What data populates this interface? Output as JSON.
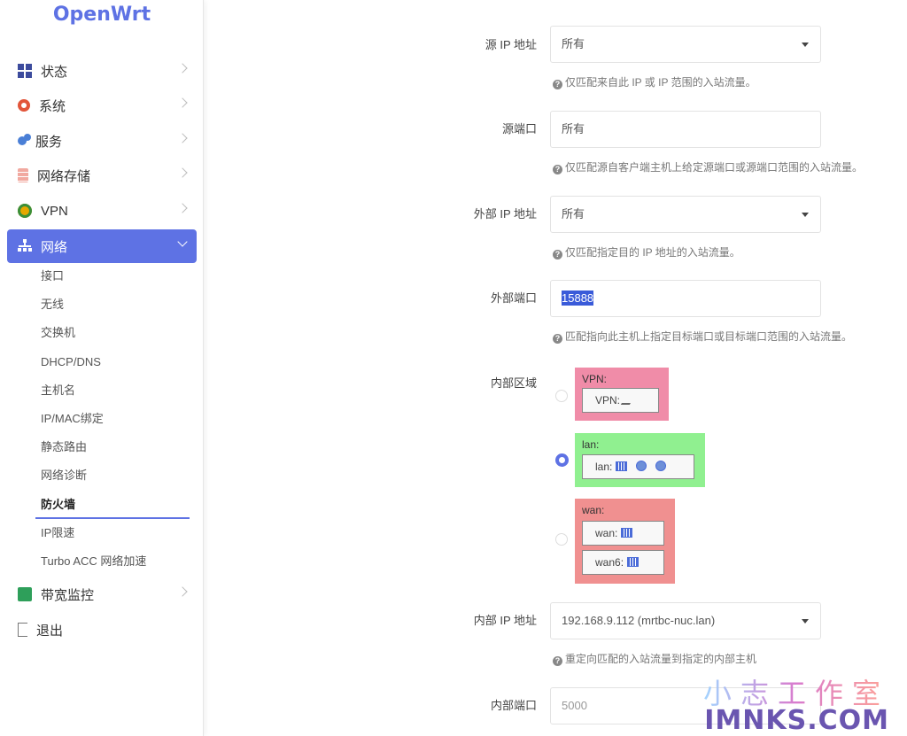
{
  "app": {
    "logo": "OpenWrt"
  },
  "sidebar": {
    "items": [
      {
        "label": "状态",
        "icon": "status-icon"
      },
      {
        "label": "系统",
        "icon": "gear-icon"
      },
      {
        "label": "服务",
        "icon": "services-icon"
      },
      {
        "label": "网络存储",
        "icon": "storage-icon"
      },
      {
        "label": "VPN",
        "icon": "vpn-icon"
      },
      {
        "label": "网络",
        "icon": "network-icon",
        "active": true
      },
      {
        "label": "带宽监控",
        "icon": "bandwidth-icon"
      },
      {
        "label": "退出",
        "icon": "logout-icon"
      }
    ],
    "submenu": [
      "接口",
      "无线",
      "交换机",
      "DHCP/DNS",
      "主机名",
      "IP/MAC绑定",
      "静态路由",
      "网络诊断",
      "防火墙",
      "IP限速",
      "Turbo ACC 网络加速"
    ],
    "current_submenu": "防火墙"
  },
  "form": {
    "src_ip": {
      "label": "源 IP 地址",
      "value": "所有",
      "hint": "仅匹配来自此 IP 或 IP 范围的入站流量。"
    },
    "src_port": {
      "label": "源端口",
      "value": "所有",
      "hint": "仅匹配源自客户端主机上给定源端口或源端口范围的入站流量。"
    },
    "ext_ip": {
      "label": "外部 IP 地址",
      "value": "所有",
      "hint": "仅匹配指定目的 IP 地址的入站流量。"
    },
    "ext_port": {
      "label": "外部端口",
      "value": "15888",
      "hint": "匹配指向此主机上指定目标端口或目标端口范围的入站流量。"
    },
    "int_zone": {
      "label": "内部区域",
      "zones": [
        {
          "name": "VPN:",
          "networks": [
            "VPN:"
          ],
          "color": "#f08ca8",
          "selected": false
        },
        {
          "name": "lan:",
          "networks": [
            "lan:"
          ],
          "color": "#90f090",
          "selected": true
        },
        {
          "name": "wan:",
          "networks": [
            "wan:",
            "wan6:"
          ],
          "color": "#f09090",
          "selected": false
        }
      ]
    },
    "int_ip": {
      "label": "内部 IP 地址",
      "value": "192.168.9.112 (mrtbc-nuc.lan)",
      "hint": "重定向匹配的入站流量到指定的内部主机"
    },
    "int_port": {
      "label": "内部端口",
      "placeholder": "5000"
    }
  },
  "watermark": {
    "cn": "小志工作室",
    "en": "IMNKS.COM"
  }
}
